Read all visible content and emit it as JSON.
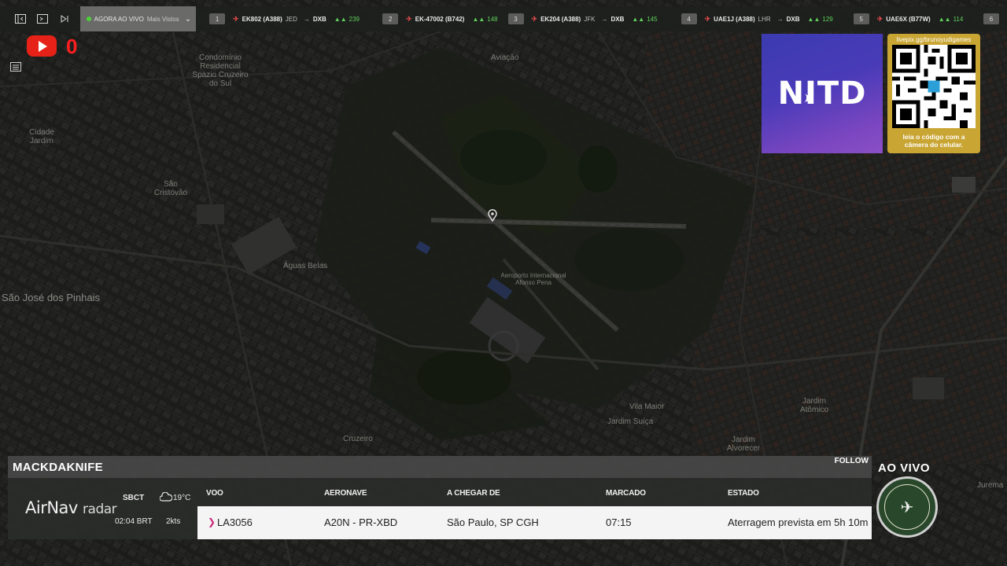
{
  "topbar": {
    "live_label": "AGORA AO VIVO",
    "live_sub": "Mais Vistos",
    "flights": [
      {
        "rank": "1",
        "flight": "EK802 (A388)",
        "from": "JED",
        "to": "DXB",
        "viewers": "239"
      },
      {
        "rank": "2",
        "flight": "EK-47002 (B742)",
        "from": "",
        "to": "",
        "viewers": "148"
      },
      {
        "rank": "3",
        "flight": "EK204 (A388)",
        "from": "JFK",
        "to": "DXB",
        "viewers": "145"
      },
      {
        "rank": "4",
        "flight": "UAE1J (A388)",
        "from": "LHR",
        "to": "DXB",
        "viewers": "129"
      },
      {
        "rank": "5",
        "flight": "UAE6X (B77W)",
        "from": "",
        "to": "",
        "viewers": "114"
      }
    ],
    "next_rank": "6"
  },
  "youtube": {
    "count": "0"
  },
  "map": {
    "labels": [
      {
        "text": "Condomínio Residencial Spazio Cruzeiro do Sul"
      },
      {
        "text": "Aviação"
      },
      {
        "text": "Cidade Jardim"
      },
      {
        "text": "São Cristóvão"
      },
      {
        "text": "Águas Belas"
      },
      {
        "text": "São José dos Pinhais"
      },
      {
        "text": "Aeroporto Internacional Afonso Pena"
      },
      {
        "text": "Vila Maior"
      },
      {
        "text": "Jardim Suíça"
      },
      {
        "text": "Jardim Atômico"
      },
      {
        "text": "Jardim Alvorecer"
      },
      {
        "text": "Cruzeiro"
      },
      {
        "text": "Jurema"
      }
    ]
  },
  "promo": {
    "logo_text": "NITD",
    "qr_url": "livepix.gg/brunoyudigames",
    "qr_caption": "leia o código com a câmera do celular."
  },
  "panel": {
    "username": "MACKDAKNIFE",
    "follow": "FOLLOW",
    "brand_main": "AirNav",
    "brand_sub": "radar",
    "airport": {
      "code": "SBCT",
      "time": "02:04 BRT",
      "temp": "19°C",
      "wind": "2kts"
    },
    "columns": {
      "flight": "VOO",
      "aircraft": "AERONAVE",
      "origin": "A CHEGAR DE",
      "scheduled": "MARCADO",
      "status": "ESTADO"
    },
    "row": {
      "flight": "LA3056",
      "aircraft": "A20N - PR-XBD",
      "origin": "São Paulo, SP CGH",
      "scheduled": "07:15",
      "status": "Aterragem prevista em 5h 10m"
    }
  },
  "overlay": {
    "live_text": "AO VIVO"
  },
  "colors": {
    "live_dot": "#4cd137",
    "youtube": "#e62117",
    "promo_gold": "#c9a533",
    "viewer_green": "#5fd05a",
    "airline_mark": "#c8287a"
  }
}
